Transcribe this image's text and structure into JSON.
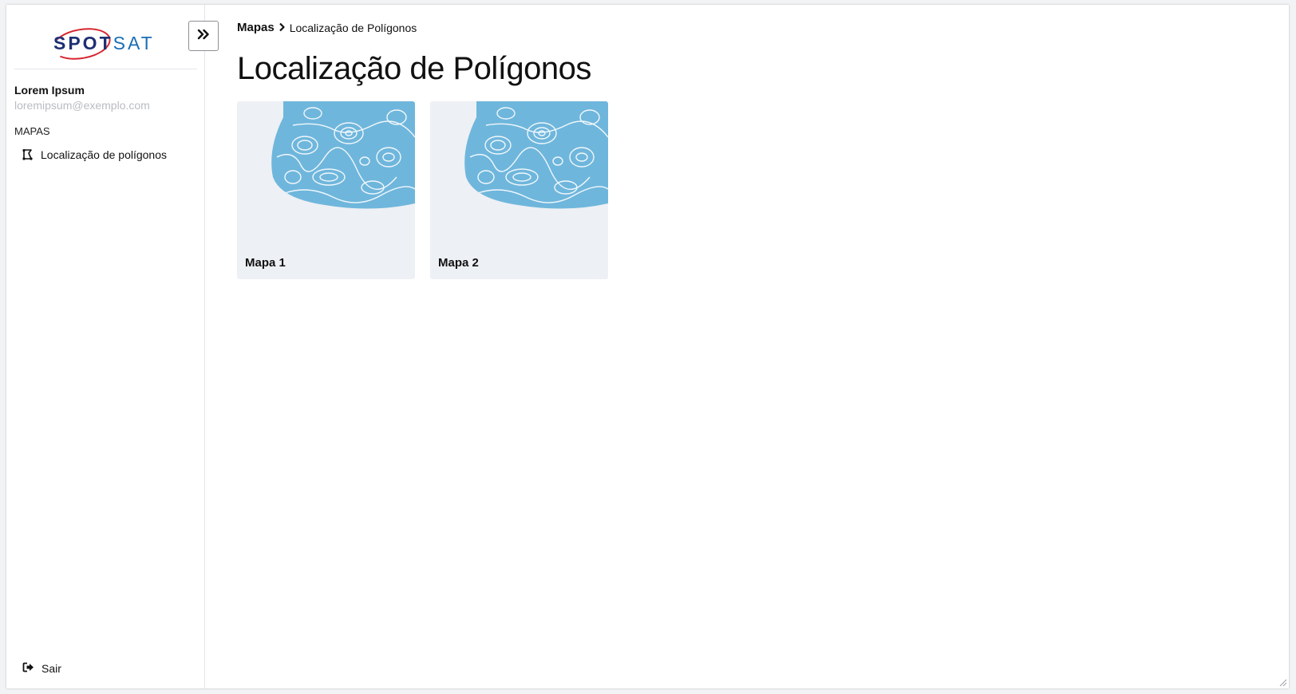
{
  "brand": {
    "logo_text_1": "SPOT",
    "logo_text_2": "SAT",
    "primary_color": "#1d2f73",
    "accent_color": "#d6252f",
    "secondary_color": "#1a6db5"
  },
  "sidebar": {
    "user": {
      "name": "Lorem Ipsum",
      "email": "loremipsum@exemplo.com"
    },
    "section_label": "MAPAS",
    "items": [
      {
        "label": "Localização de polígonos",
        "icon": "polygon-map-icon"
      }
    ],
    "logout_label": "Sair",
    "logout_icon": "sign-out-icon"
  },
  "toolbar": {
    "toggle_icon": "double-chevron-right-icon"
  },
  "breadcrumb": {
    "root": "Mapas",
    "current": "Localização de Polígonos"
  },
  "page": {
    "title": "Localização de Polígonos"
  },
  "cards": [
    {
      "label": "Mapa 1",
      "thumb_color": "#6fb6dc"
    },
    {
      "label": "Mapa 2",
      "thumb_color": "#6fb6dc"
    }
  ]
}
